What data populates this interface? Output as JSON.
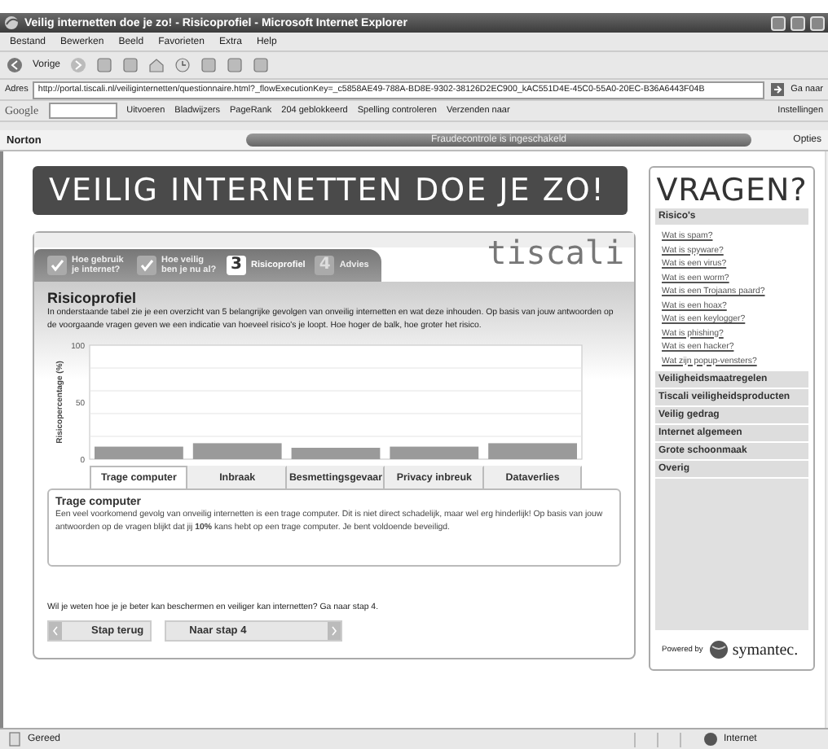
{
  "window": {
    "title": "Veilig internetten doe je zo! - Risicoprofiel - Microsoft Internet Explorer"
  },
  "menu": [
    "Bestand",
    "Bewerken",
    "Beeld",
    "Favorieten",
    "Extra",
    "Help"
  ],
  "toolbar": {
    "back": "Vorige"
  },
  "address": {
    "label": "Adres",
    "url": "http://portal.tiscali.nl/veiliginternetten/questionnaire.html?_flowExecutionKey=_c5858AE49-788A-BD8E-9302-38126D2EC900_kAC551D4E-45C0-55A0-20EC-B36A6443F04B",
    "go": "Ga naar"
  },
  "google_bar": {
    "logo": "Google",
    "search": "Uitvoeren",
    "bookmarks": "Bladwijzers",
    "pagerank": "PageRank",
    "blocked": "204 geblokkeerd",
    "spelling": "Spelling controleren",
    "send": "Verzenden naar",
    "settings": "Instellingen"
  },
  "norton_bar": {
    "logo": "Norton",
    "status": "Fraudecontrole is ingeschakeld",
    "options": "Opties"
  },
  "page": {
    "banner": "VEILIG INTERNETTEN DOE JE ZO!",
    "brand": "tiscali",
    "steps": [
      {
        "kind": "done",
        "label": "Hoe gebruik je internet?"
      },
      {
        "kind": "done",
        "label": "Hoe veilig ben je nu al?"
      },
      {
        "kind": "current",
        "number": "3",
        "label": "Risicoprofiel"
      },
      {
        "kind": "todo",
        "number": "4",
        "label": "Advies"
      }
    ],
    "heading": "Risicoprofiel",
    "intro": "In onderstaande tabel zie je een overzicht van 5 belangrijke gevolgen van onveilig internetten en wat deze inhouden. Op basis van jouw antwoorden op de voorgaande vragen geven we een indicatie van hoeveel risico's je loopt. Hoe hoger de balk, hoe groter het risico.",
    "chart_data": {
      "type": "bar",
      "ylabel": "Risicopercentage (%)",
      "categories": [
        "Trage computer",
        "Inbraak",
        "Besmettingsgevaar",
        "Privacy inbreuk",
        "Dataverlies"
      ],
      "values": [
        11,
        14,
        10,
        11,
        14
      ],
      "ylim": [
        0,
        100
      ],
      "yticks": [
        0,
        50,
        100
      ]
    },
    "category_tabs": [
      {
        "selected": true
      },
      {
        "selected": false
      },
      {
        "selected": false
      },
      {
        "selected": false
      },
      {
        "selected": false
      }
    ],
    "detail": {
      "title": "Trage computer",
      "text": "Een veel voorkomend gevolg van onveilig internetten is een trage computer. Dit is niet direct schadelijk, maar wel erg hinderlijk! Op basis van jouw antwoorden op de vragen blijkt dat jij **10%** kans hebt op een trage computer. Je bent voldoende beveiligd."
    },
    "prompt": "Wil je weten hoe je je beter kan beschermen en veiliger kan internetten? Ga naar stap 4.",
    "back_button": "Stap terug",
    "next_button": "Naar stap 4"
  },
  "sidebar": {
    "title": "VRAGEN?",
    "sections": [
      {
        "label": "Risico's",
        "expanded": true,
        "links": [
          "Wat is spam?",
          "Wat is spyware?",
          "Wat is een virus?",
          "Wat is een worm?",
          "Wat is een Trojaans paard?",
          "Wat is een hoax?",
          "Wat is een keylogger?",
          "Wat is phishing?",
          "Wat is een hacker?",
          "Wat zijn popup-vensters?"
        ]
      },
      {
        "label": "Veiligheidsmaatregelen",
        "expanded": false
      },
      {
        "label": "Tiscali veiligheidsproducten",
        "expanded": false
      },
      {
        "label": "Veilig gedrag",
        "expanded": false
      },
      {
        "label": "Internet algemeen",
        "expanded": false
      },
      {
        "label": "Grote schoonmaak",
        "expanded": false
      },
      {
        "label": "Overig",
        "expanded": false
      }
    ],
    "powered": "Powered by",
    "partner": "symantec."
  },
  "status_bar": {
    "status": "Gereed",
    "zone": "Internet"
  }
}
